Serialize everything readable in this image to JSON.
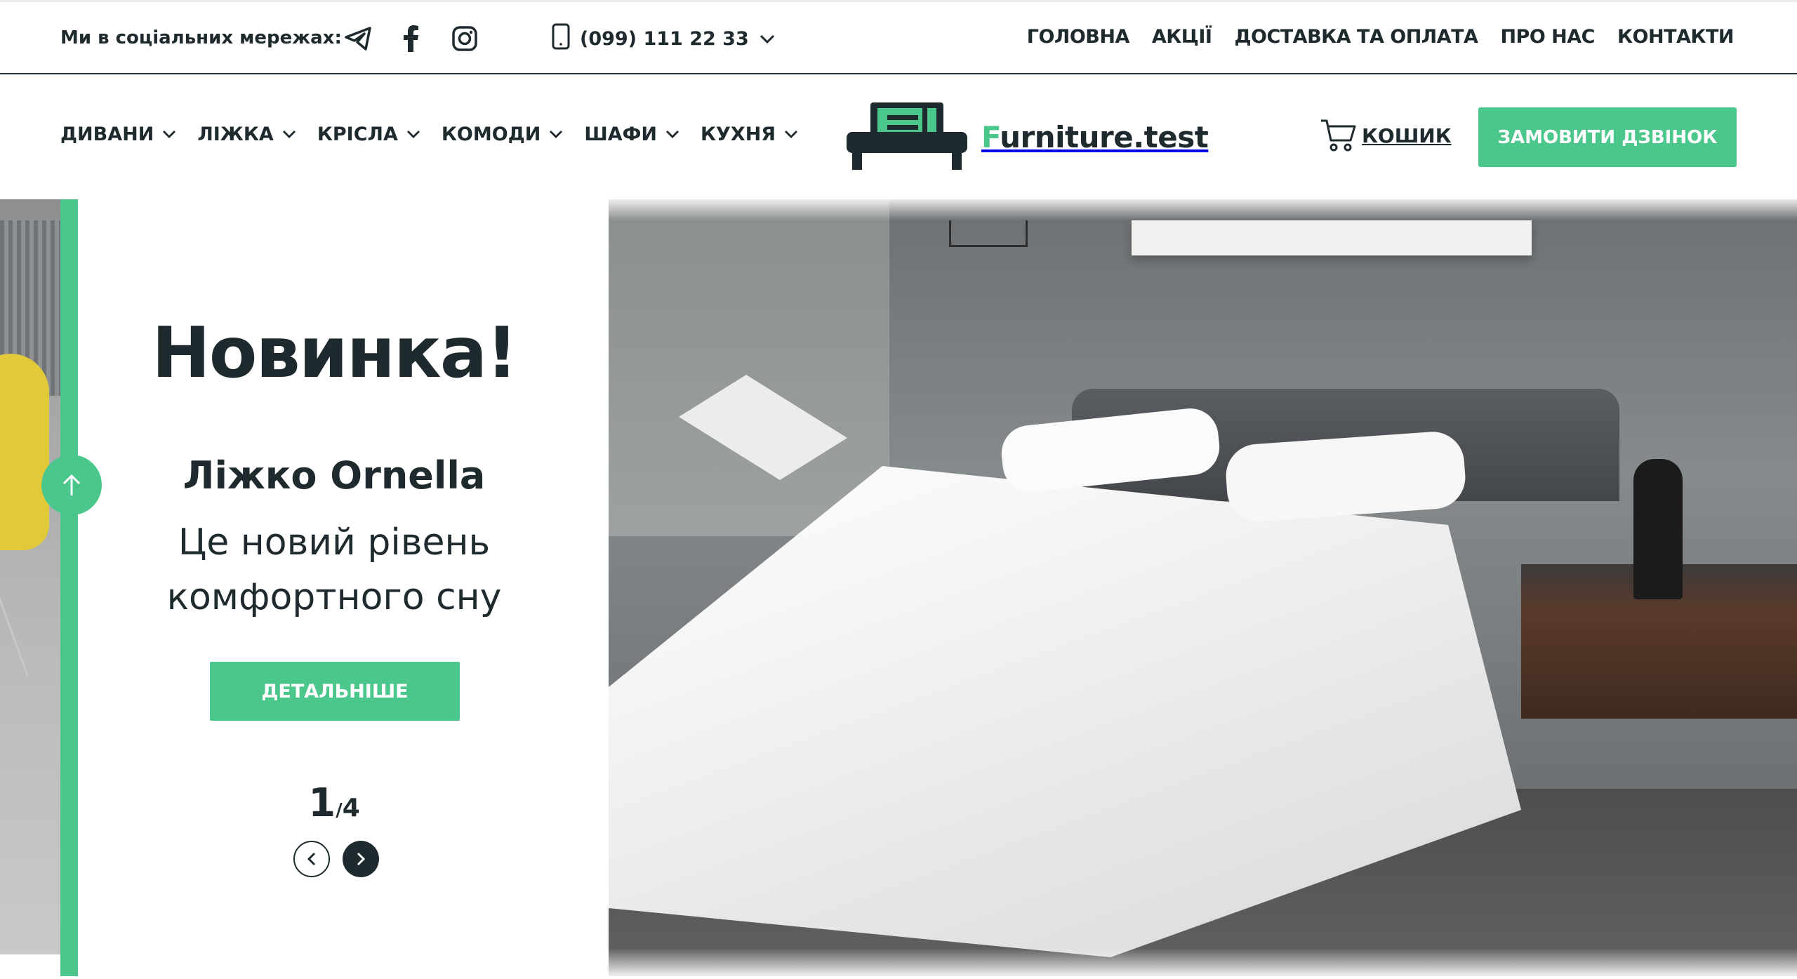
{
  "topbar": {
    "social_label": "Ми в соціальних мережах:",
    "social_icons": [
      "telegram-icon",
      "facebook-icon",
      "instagram-icon"
    ],
    "phone": "(099) 111 22 33",
    "nav": [
      "ГОЛОВНА",
      "АКЦІЇ",
      "ДОСТАВКА ТА ОПЛАТА",
      "ПРО НАС",
      "КОНТАКТИ"
    ]
  },
  "header": {
    "categories": [
      "ДИВАНИ",
      "ЛІЖКА",
      "КРІСЛА",
      "КОМОДИ",
      "ШАФИ",
      "КУХНЯ"
    ],
    "logo_first_letter": "F",
    "logo_rest": "urniture.test",
    "cart_label": "КОШИК",
    "callback_label": "ЗАМОВИТИ ДЗВІНОК"
  },
  "hero": {
    "title": "Новинка!",
    "subtitle": "Ліжко Ornella",
    "description": "Це новий рівень комфортного сну",
    "button_label": "ДЕТАЛЬНІШЕ",
    "current_slide": "1",
    "separator": "/",
    "total_slides": "4"
  },
  "colors": {
    "accent": "#4cc78b",
    "dark": "#1e2a2e",
    "white": "#ffffff"
  }
}
